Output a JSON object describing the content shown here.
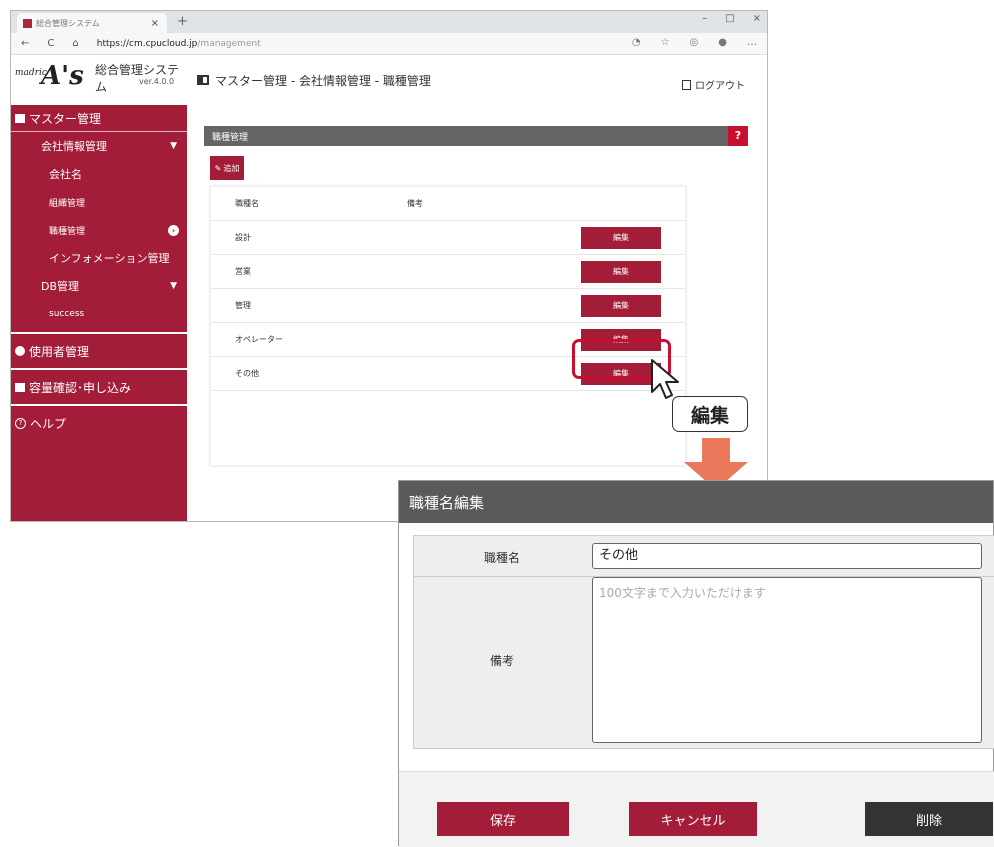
{
  "browser": {
    "tab_title": "総合管理システム",
    "tab_close": "×",
    "tab_add": "+",
    "url_host": "https://cm.cpucloud.jp",
    "url_path": "/management"
  },
  "app": {
    "brand_small": "madric",
    "brand_big": "A's",
    "system_name": "総合管理システム",
    "version": "ver.4.0.0",
    "breadcrumb": "マスター管理 - 会社情報管理 - 職種管理",
    "logout": "ログアウト"
  },
  "sidebar": {
    "master": "マスター管理",
    "company_info": "会社情報管理",
    "company_name": "会社名",
    "org": "組織管理",
    "job": "職種管理",
    "information": "インフォメーション管理",
    "db": "DB管理",
    "success": "success",
    "users": "使用者管理",
    "capacity": "容量確認･申し込み",
    "help": "ヘルプ"
  },
  "panel": {
    "title": "職種管理",
    "help": "?",
    "add": "追加",
    "col_name": "職種名",
    "col_note": "備考",
    "rows": [
      {
        "name": "設計",
        "edit": "編集"
      },
      {
        "name": "営業",
        "edit": "編集"
      },
      {
        "name": "管理",
        "edit": "編集"
      },
      {
        "name": "オペレーター",
        "edit": "編集"
      },
      {
        "name": "その他",
        "edit": "編集"
      }
    ]
  },
  "callout": "編集",
  "dialog": {
    "title": "職種名編集",
    "label_name": "職種名",
    "name_value": "その他",
    "label_note": "備考",
    "note_placeholder": "100文字まで入力いただけます",
    "save": "保存",
    "cancel": "キャンセル",
    "delete": "削除"
  },
  "colors": {
    "brand": "#a31d38",
    "dialog_header": "#5a5a5a",
    "delete": "#333333"
  }
}
